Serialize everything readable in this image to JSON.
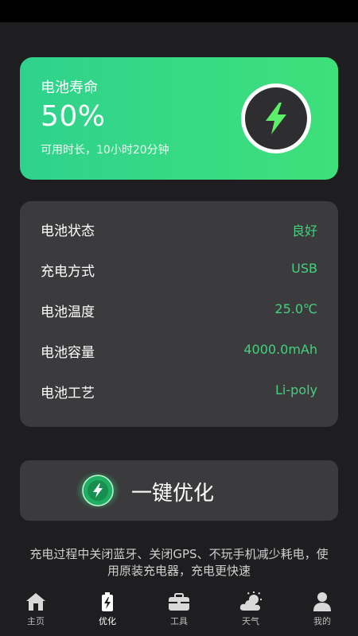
{
  "battery": {
    "title": "电池寿命",
    "percent": "50%",
    "subtitle": "可用时长，10小时20分钟",
    "accent": "#3ee07a",
    "icon": "lightning-icon"
  },
  "info_rows": [
    {
      "label": "电池状态",
      "value": "良好"
    },
    {
      "label": "充电方式",
      "value": "USB"
    },
    {
      "label": "电池温度",
      "value": "25.0℃"
    },
    {
      "label": "电池容量",
      "value": "4000.0mAh"
    },
    {
      "label": "电池工艺",
      "value": "Li-poly"
    }
  ],
  "optimize": {
    "label": "一键优化",
    "icon": "lightning-icon"
  },
  "tip": "充电过程中关闭蓝牙、关闭GPS、不玩手机减少耗电，使用原装充电器，充电更快速",
  "tabs": [
    {
      "label": "主页",
      "icon": "home-icon"
    },
    {
      "label": "优化",
      "icon": "battery-bolt-icon"
    },
    {
      "label": "工具",
      "icon": "toolbox-icon"
    },
    {
      "label": "天气",
      "icon": "weather-icon"
    },
    {
      "label": "我的",
      "icon": "person-icon"
    }
  ],
  "colors": {
    "value_green": "#44d07f",
    "card_bg": "#3b3b3d",
    "page_bg": "#1e1e20"
  }
}
